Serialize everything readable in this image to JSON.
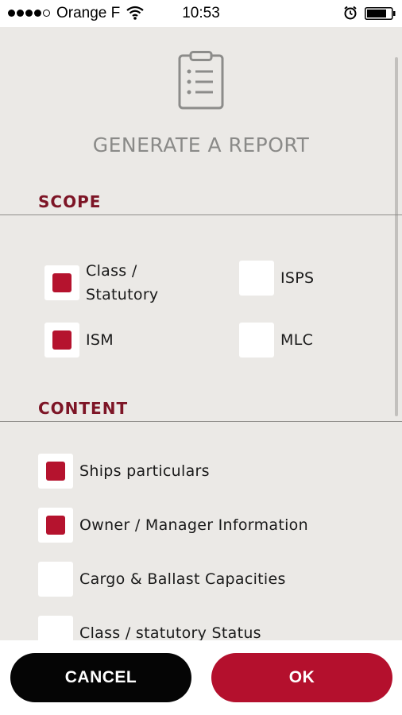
{
  "status_bar": {
    "carrier": "Orange F",
    "time": "10:53"
  },
  "page": {
    "title": "GENERATE A REPORT"
  },
  "scope": {
    "heading": "SCOPE",
    "items": [
      {
        "label": "Class /\nStatutory",
        "checked": true
      },
      {
        "label": "ISPS",
        "checked": false
      },
      {
        "label": "ISM",
        "checked": true
      },
      {
        "label": "MLC",
        "checked": false
      }
    ]
  },
  "content": {
    "heading": "CONTENT",
    "items": [
      {
        "label": "Ships particulars",
        "checked": true
      },
      {
        "label": "Owner / Manager Information",
        "checked": true
      },
      {
        "label": "Cargo & Ballast Capacities",
        "checked": false
      },
      {
        "label": "Class / statutory Status",
        "checked": false
      }
    ]
  },
  "footer": {
    "cancel_label": "CANCEL",
    "ok_label": "OK"
  },
  "colors": {
    "accent": "#b4102d",
    "heading": "#7d1526",
    "background": "#ebe9e6"
  }
}
